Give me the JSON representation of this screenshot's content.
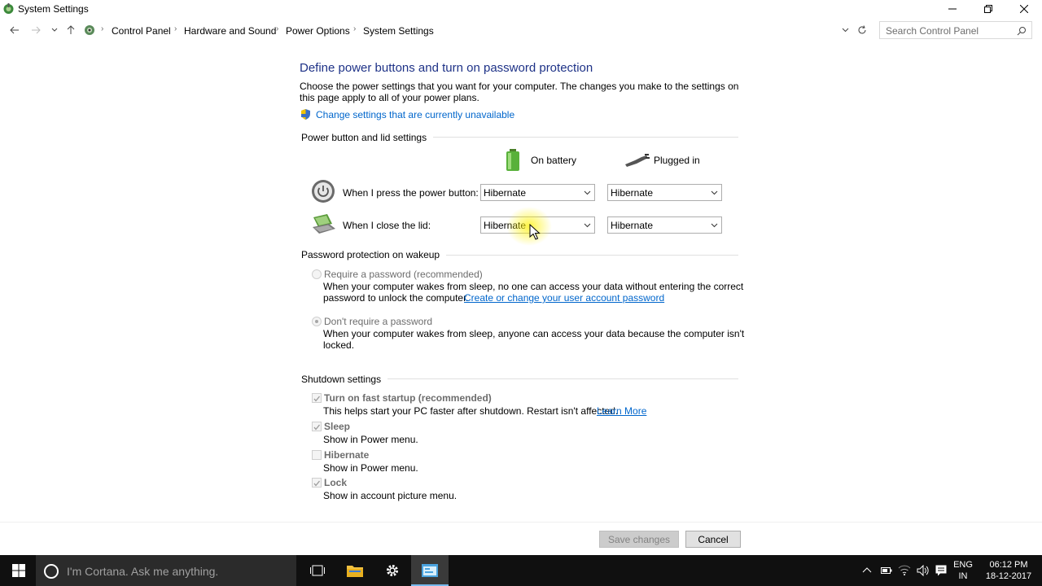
{
  "window": {
    "title": "System Settings",
    "icon": "power-options-icon"
  },
  "breadcrumbs": [
    "Control Panel",
    "Hardware and Sound",
    "Power Options",
    "System Settings"
  ],
  "search": {
    "placeholder": "Search Control Panel"
  },
  "page": {
    "heading": "Define power buttons and turn on password protection",
    "description": "Choose the power settings that you want for your computer. The changes you make to the settings on this page apply to all of your power plans.",
    "change_link": "Change settings that are currently unavailable"
  },
  "power_section": {
    "label": "Power button and lid settings",
    "col_battery": "On battery",
    "col_plugged": "Plugged in",
    "rows": [
      {
        "label": "When I press the power button:",
        "battery": "Hibernate",
        "plugged": "Hibernate"
      },
      {
        "label": "When I close the lid:",
        "battery": "Hibernate",
        "plugged": "Hibernate"
      }
    ]
  },
  "password_section": {
    "label": "Password protection on wakeup",
    "require": {
      "label": "Require a password (recommended)",
      "desc1": "When your computer wakes from sleep, no one can access your data without entering the correct",
      "desc2": "password to unlock the computer.",
      "link": "Create or change your user account password",
      "checked": false
    },
    "dont_require": {
      "label": "Don't require a password",
      "desc1": "When your computer wakes from sleep, anyone can access your data because the computer isn't",
      "desc2": "locked.",
      "checked": true
    }
  },
  "shutdown_section": {
    "label": "Shutdown settings",
    "options": [
      {
        "label": "Turn on fast startup (recommended)",
        "desc": "This helps start your PC faster after shutdown. Restart isn't affected.",
        "link": "Learn More",
        "checked": true
      },
      {
        "label": "Sleep",
        "desc": "Show in Power menu.",
        "checked": true
      },
      {
        "label": "Hibernate",
        "desc": "Show in Power menu.",
        "checked": false
      },
      {
        "label": "Lock",
        "desc": "Show in account picture menu.",
        "checked": true
      }
    ]
  },
  "buttons": {
    "save": "Save changes",
    "cancel": "Cancel"
  },
  "taskbar": {
    "cortana_placeholder": "I'm Cortana. Ask me anything.",
    "lang_top": "ENG",
    "lang_bottom": "IN",
    "time": "06:12 PM",
    "date": "18-12-2017"
  },
  "colors": {
    "heading": "#1e3287",
    "link": "#0066cc",
    "taskbar": "#101010"
  }
}
